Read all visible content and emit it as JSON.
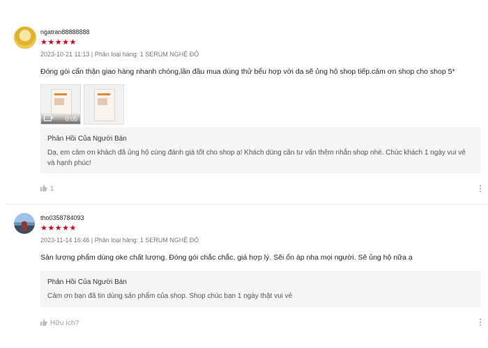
{
  "reviews": [
    {
      "username": "ngatran88888888",
      "stars": "★★★★★",
      "meta": "2023-10-21 11:13 | Phân loại hàng: 1 SERUM NGHỆ ĐỎ",
      "content": "Đóng gói cẩn thận giao hàng nhanh chóng,lần đầu mua dùng thử bểu hợp với da sẽ ủng hộ shop tiếp.cảm ơn shop cho shop 5*",
      "media": [
        {
          "type": "video",
          "duration": "0:05",
          "icon": "video-camera-icon"
        },
        {
          "type": "image"
        }
      ],
      "reply": {
        "title": "Phản Hồi Của Người Bán",
        "text": "Dạ, em cảm ơn khách đã ủng hộ cùng đánh giá tốt cho shop ạ! Khách dùng cần tư vấn thêm nhắn shop nhé. Chúc khách 1 ngày vui vẻ và hạnh phúc!"
      },
      "likes": "1",
      "like_icon": "thumbs-up-icon"
    },
    {
      "username": "tho0358784093",
      "stars": "★★★★★",
      "meta": "2023-11-14 16:46 | Phân loại hàng: 1 SERUM NGHỆ ĐỎ",
      "content": "Sản lượng phẩm dùng oke chất lượng. Đóng gói chắc chắc, giá hợp lý. Sẽi ổn áp nha mọi người. Sẽ ủng hộ nữa ạ",
      "reply": {
        "title": "Phản Hồi Của Người Bán",
        "text": "Cảm ơn bạn đã tin dùng sản phẩm của shop. Shop chúc bạn 1 ngày thật vui vẻ"
      },
      "likes": "Hữu ích?",
      "like_icon": "thumbs-up-icon"
    }
  ],
  "colors": {
    "star": "#d0011b",
    "reply_bg": "#f5f5f5",
    "meta": "#757575"
  }
}
